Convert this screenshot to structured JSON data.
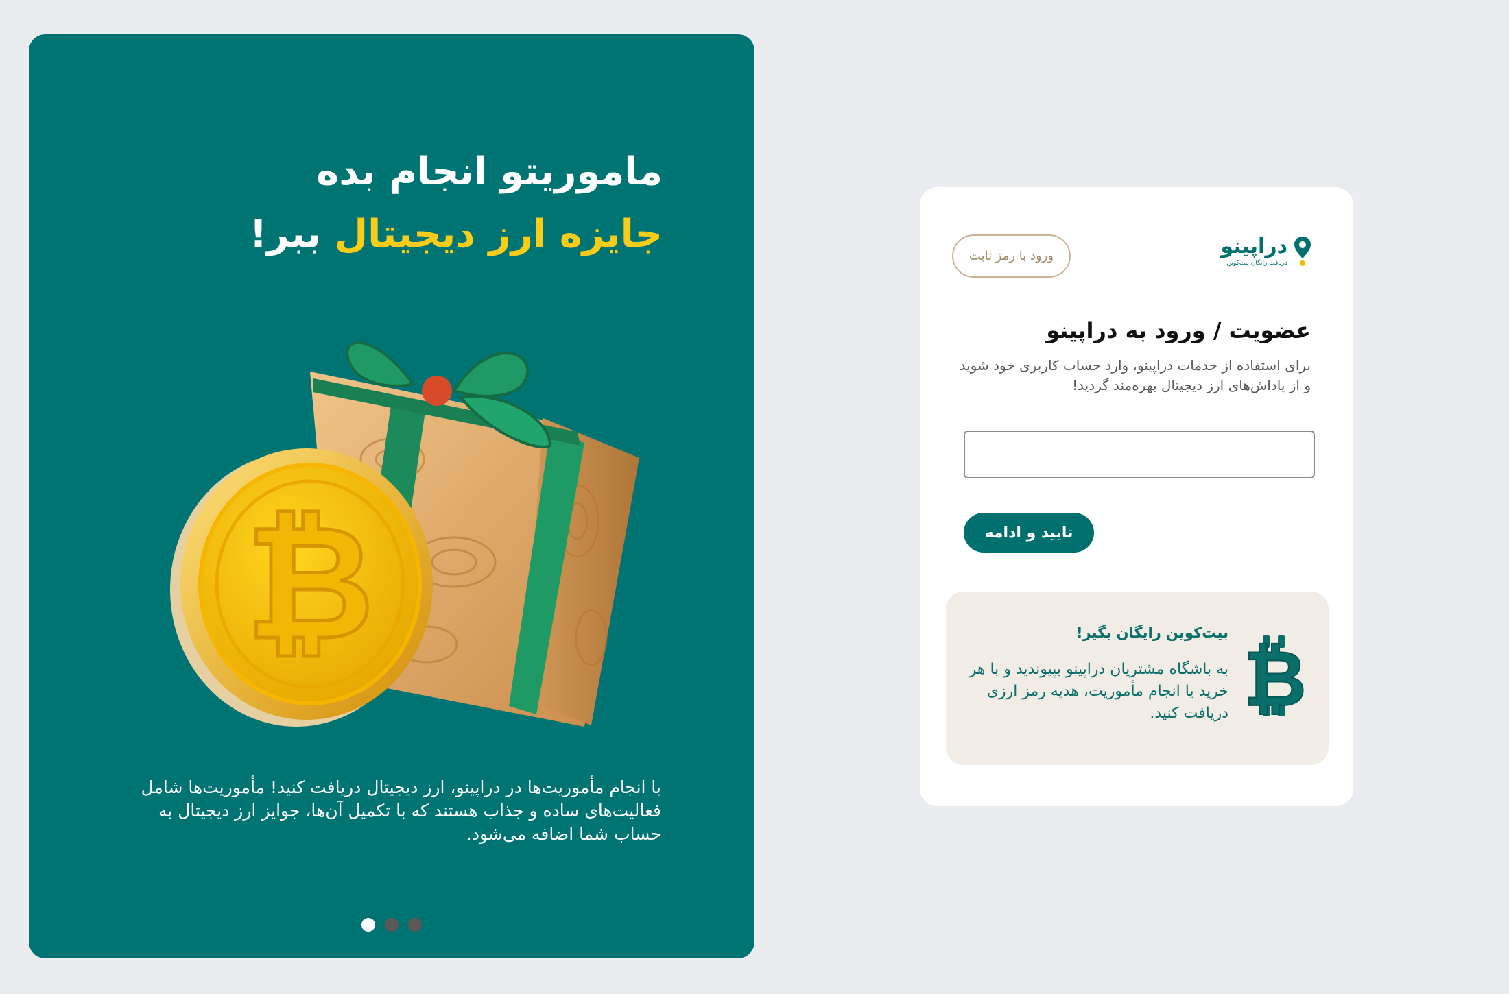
{
  "promo": {
    "headline_line1": "ماموریتو انجام بده",
    "headline_highlight": "جایزه ارز دیجیتال",
    "headline_line2_rest": "ببر!",
    "body": "با انجام مأموریت‌ها در دراپینو، ارز دیجیتال دریافت کنید! مأموریت‌ها شامل فعالیت‌های ساده و جذاب هستند که با تکمیل آن‌ها، جوایز ارز دیجیتال به حساب شما اضافه می‌شود.",
    "illustration_icon": "bitcoin-coin-gift-box-illustration",
    "carousel": {
      "slide_count": 3,
      "active_index": 0
    }
  },
  "login": {
    "brand_name": "دراپینو",
    "brand_tagline": "دریافت رایگان بیت‌کوین",
    "brand_icon": "location-pin-icon",
    "fixed_password_button": "ورود با رمز ثابت",
    "title": "عضویت / ورود به دراپینو",
    "description": "برای استفاده از خدمات دراپینو، وارد حساب کاربری خود شوید و از پاداش‌های ارز دیجیتال بهره‌مند گردید!",
    "phone_input_value": "",
    "submit_button": "تایید و ادامه",
    "promo_box_title": "بیت‌کوین رایگان بگیر!",
    "promo_box_text": "به باشگاه مشتریان دراپینو بپیوندید و با هر خرید یا انجام مأموریت، هدیه رمز ارزی دریافت کنید.",
    "promo_box_icon": "bitcoin-icon"
  },
  "colors": {
    "background": "#ebecef",
    "promo_panel": "#007473",
    "headline_highlight": "#f8cc17",
    "brand_teal": "#00706e",
    "promo_box_bg": "#f1ede6",
    "pin_accent": "#f6b900",
    "outline_button_border": "#c9b396"
  }
}
